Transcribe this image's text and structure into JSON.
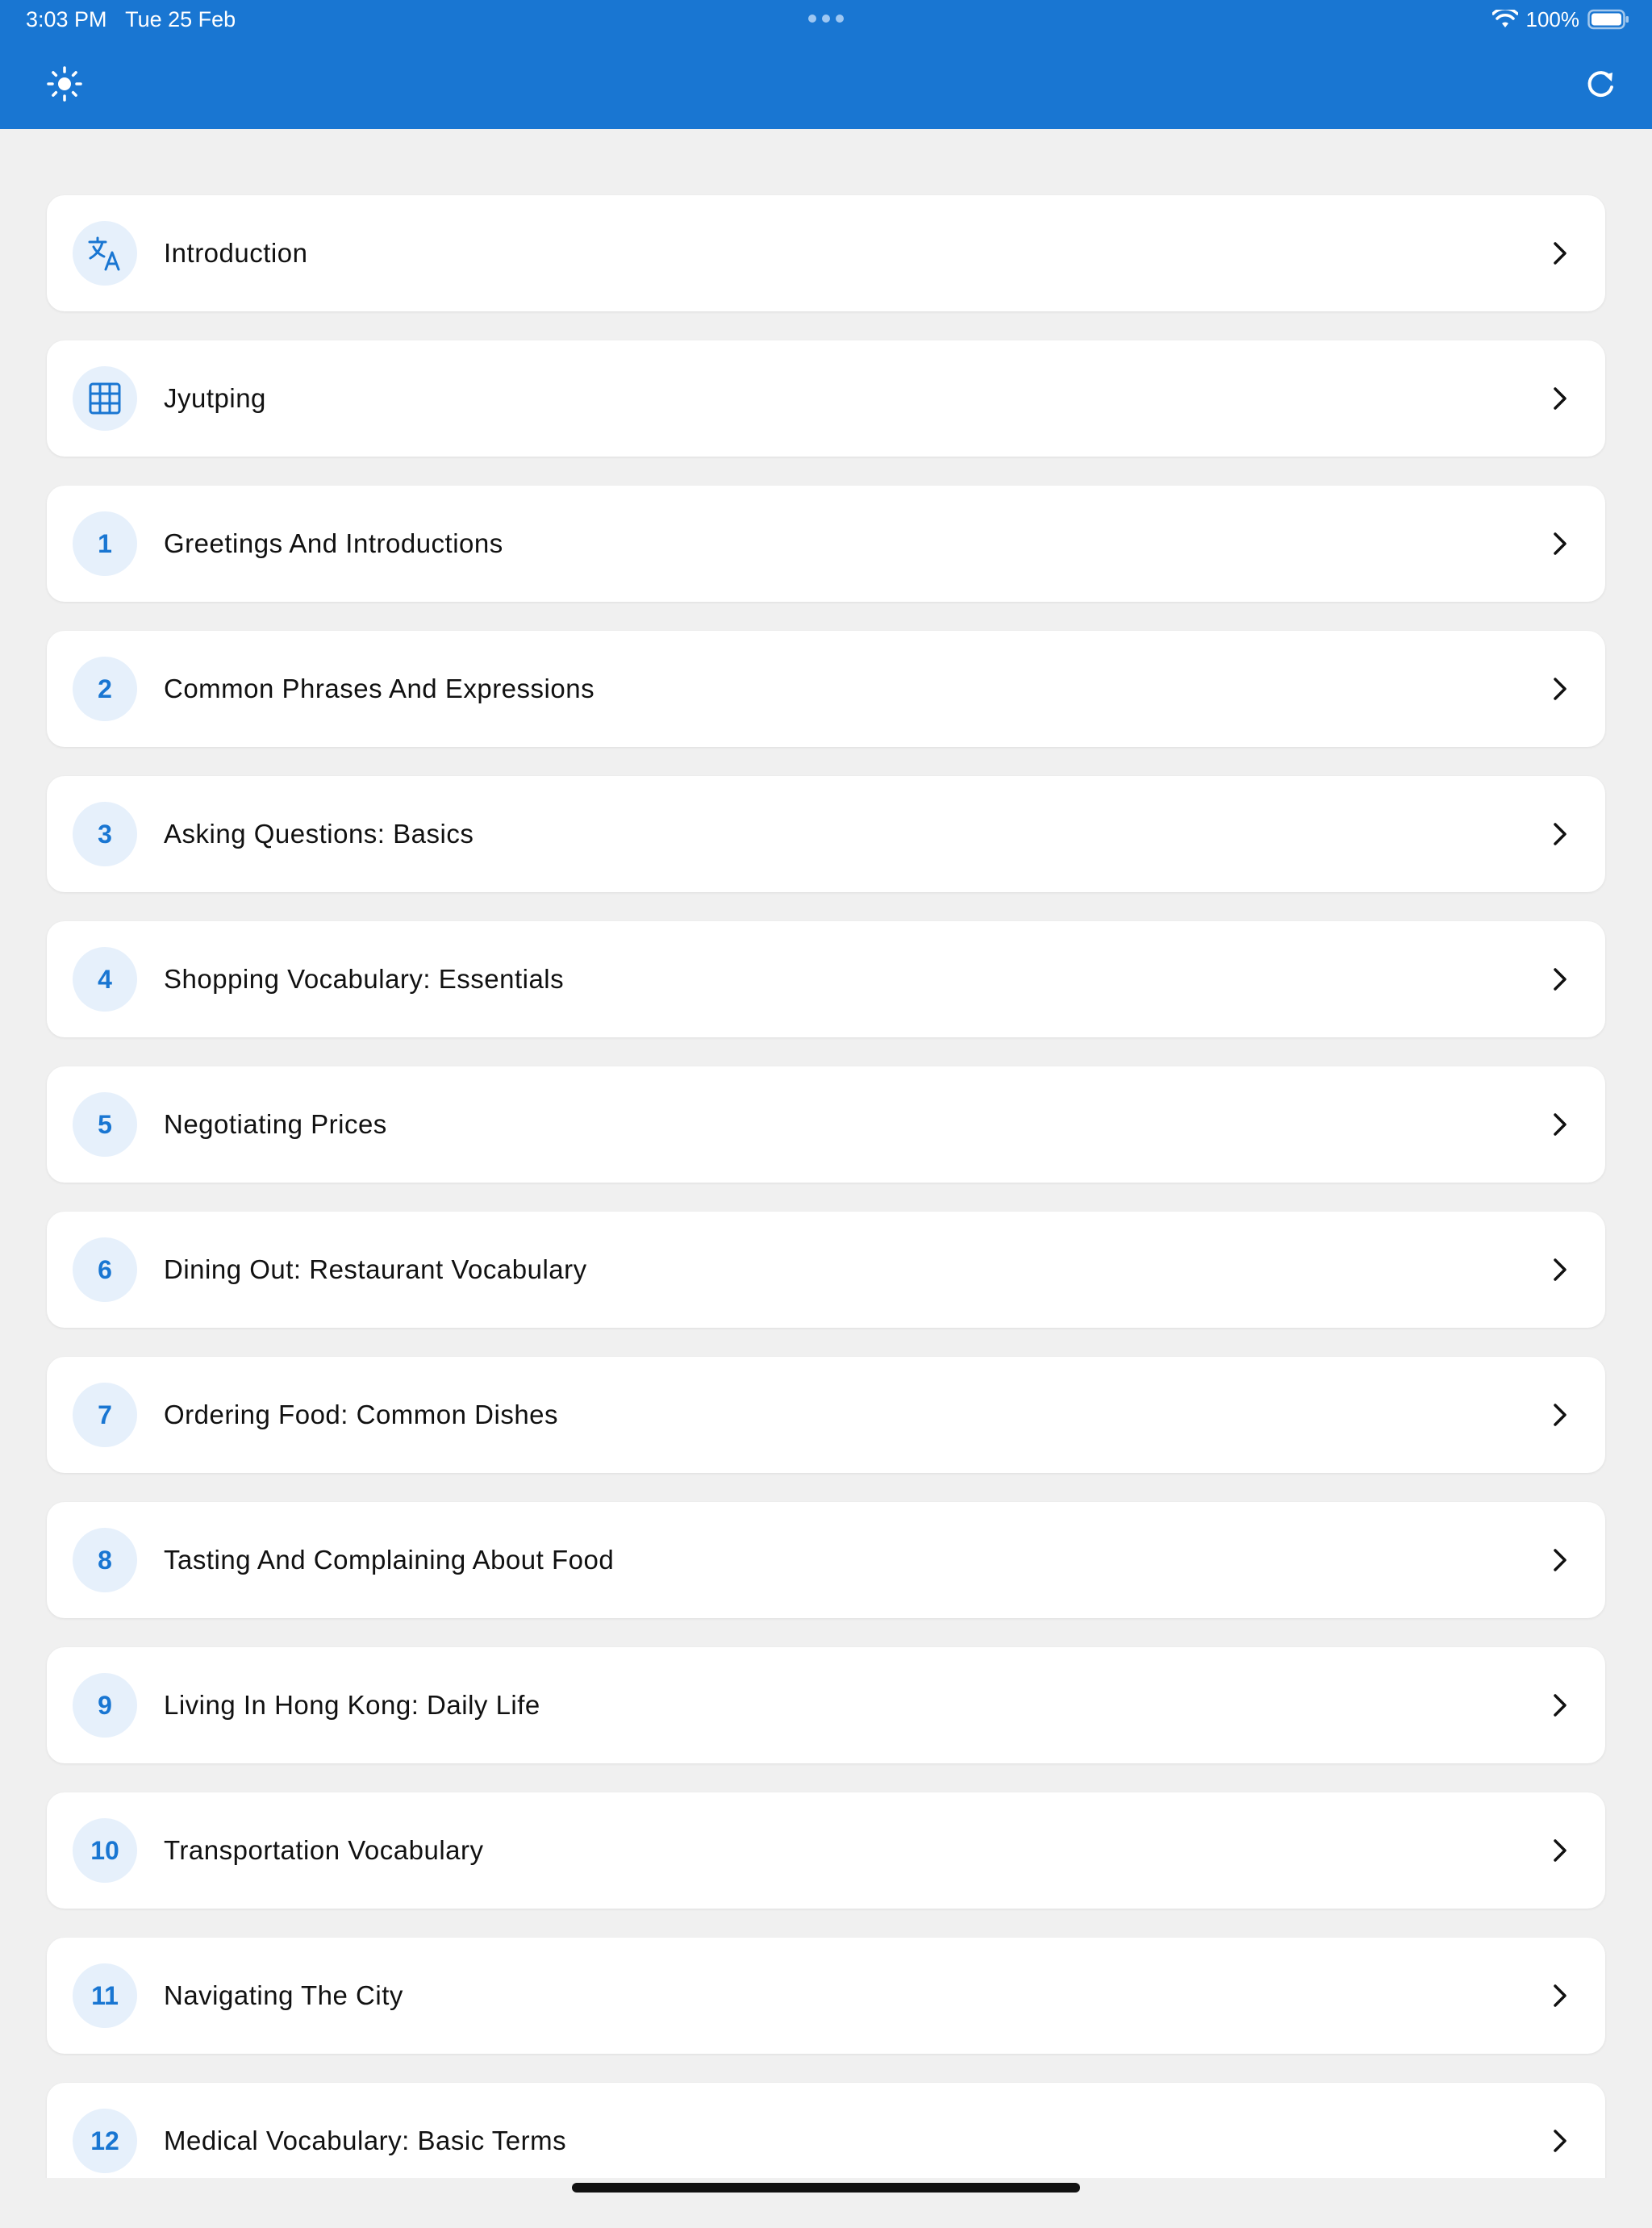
{
  "status_bar": {
    "time": "3:03 PM",
    "date": "Tue 25 Feb",
    "battery": "100%"
  },
  "toolbar": {
    "theme_icon": "sun-icon",
    "refresh_icon": "refresh-icon"
  },
  "colors": {
    "primary": "#1976d2",
    "badge_bg": "#e6f0fb",
    "background": "#f0f0f0"
  },
  "lessons": [
    {
      "badge": "",
      "icon": "translate-icon",
      "title": "Introduction"
    },
    {
      "badge": "",
      "icon": "grid-icon",
      "title": "Jyutping"
    },
    {
      "badge": "1",
      "title": "Greetings And Introductions"
    },
    {
      "badge": "2",
      "title": "Common Phrases And Expressions"
    },
    {
      "badge": "3",
      "title": "Asking Questions: Basics"
    },
    {
      "badge": "4",
      "title": "Shopping Vocabulary: Essentials"
    },
    {
      "badge": "5",
      "title": "Negotiating Prices"
    },
    {
      "badge": "6",
      "title": "Dining Out: Restaurant Vocabulary"
    },
    {
      "badge": "7",
      "title": "Ordering Food: Common Dishes"
    },
    {
      "badge": "8",
      "title": "Tasting And Complaining About Food"
    },
    {
      "badge": "9",
      "title": "Living In Hong Kong: Daily Life"
    },
    {
      "badge": "10",
      "title": "Transportation Vocabulary"
    },
    {
      "badge": "11",
      "title": "Navigating The City"
    },
    {
      "badge": "12",
      "title": "Medical Vocabulary: Basic Terms"
    }
  ]
}
